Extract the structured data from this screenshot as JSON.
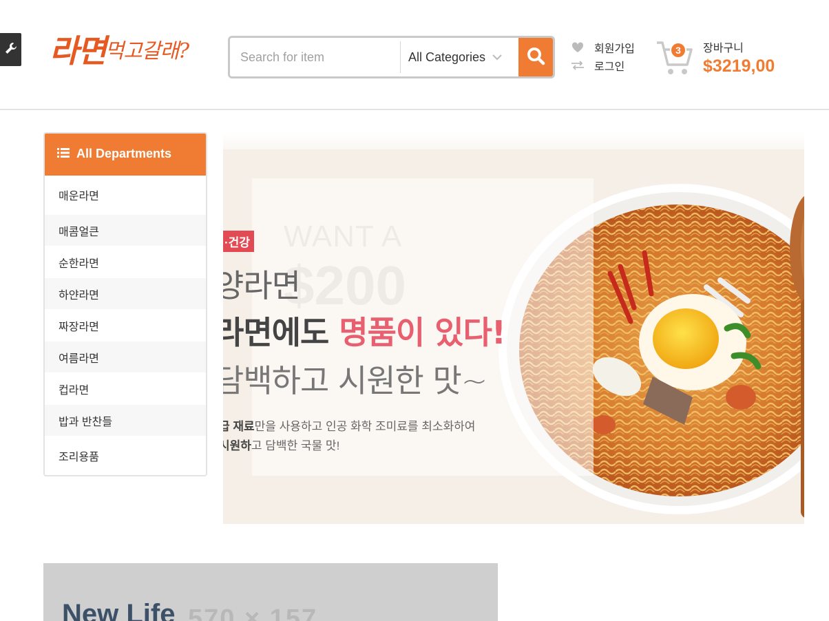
{
  "header": {
    "logo_main": "라면",
    "logo_sub": "먹고갈래?",
    "search": {
      "placeholder": "Search for item",
      "category": "All Categories"
    },
    "links": {
      "signup": "회원가입",
      "login": "로그인"
    },
    "cart": {
      "count": "3",
      "label": "장바구니",
      "total": "$3219,00"
    }
  },
  "sidebar": {
    "title": "All Departments",
    "items": [
      {
        "label": "매운라면"
      },
      {
        "label": "매콤얼큰"
      },
      {
        "label": "순한라면"
      },
      {
        "label": "하얀라면"
      },
      {
        "label": "짜장라면"
      },
      {
        "label": "여름라면"
      },
      {
        "label": "컵라면"
      },
      {
        "label": "밥과 반찬들"
      },
      {
        "label": "조리용품"
      }
    ]
  },
  "banner": {
    "ghost_text": "WANT A",
    "ghost_price": "$200",
    "tag": "·건강",
    "line1": "양라면",
    "line2_prefix": "라면에도",
    "line2_accent": "명품이 있다!",
    "line3": "담백하고 시원한 맛~",
    "sub1_bold": "급 재료",
    "sub1_rest": "만을 사용하고 인공 화학 조미료를 최소화하여",
    "sub2_bold": "시원하",
    "sub2_rest": "고 담백한 국물 맛!"
  },
  "promo": {
    "title": "New Life",
    "size": "570 × 157"
  },
  "colors": {
    "accent": "#f07c33",
    "banner_pink": "#e86070",
    "tag_red": "#e24b53"
  }
}
